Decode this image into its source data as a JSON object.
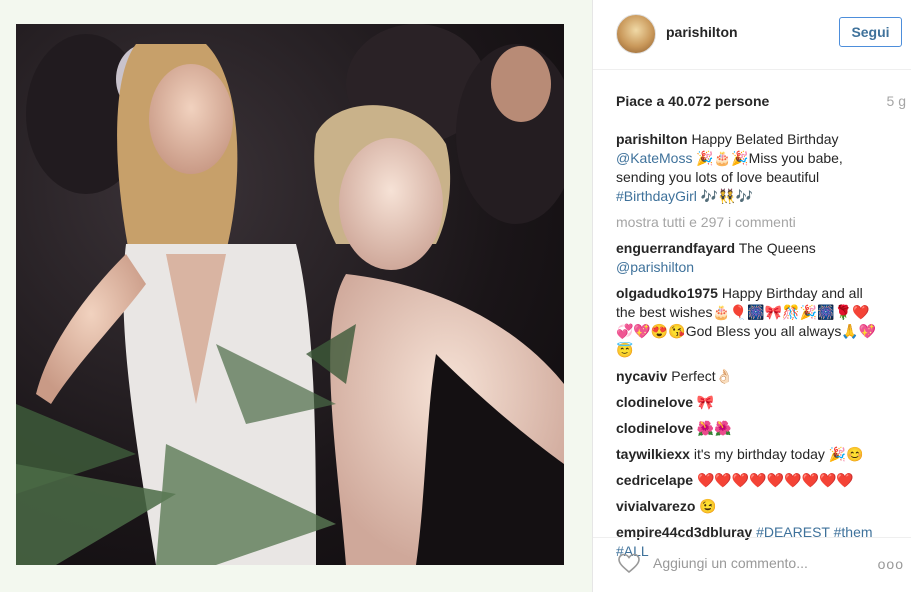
{
  "post": {
    "username": "parishilton",
    "follow_label": "Segui",
    "likes": "Piace a 40.072 persone",
    "age": "5 g",
    "view_all": "mostra tutti e 297 i commenti",
    "add_comment_placeholder": "Aggiungi un commento...",
    "options_label": "ooo"
  },
  "caption": {
    "user": "parishilton",
    "text1": "Happy Belated Birthday",
    "mention": "@KateMoss",
    "text2": "🎉🎂🎉Miss you babe, sending you lots of love beautiful",
    "hashtag": "#BirthdayGirl",
    "text3": "🎶👯🎶"
  },
  "comments": [
    {
      "user": "enguerrandfayard",
      "text": "The Queens",
      "link": "@parishilton"
    },
    {
      "user": "olgadudko1975",
      "text": "Happy Birthday and all the best wishes🎂🎈🎆🎀🎊🎉🎆🌹❤️💞💖😍😘God Bless you all always🙏💖😇"
    },
    {
      "user": "nycaviv",
      "text": "Perfect👌🏻"
    },
    {
      "user": "clodinelove",
      "text": "🎀"
    },
    {
      "user": "clodinelove",
      "text": "🌺🌺"
    },
    {
      "user": "taywilkiexx",
      "text": "it's my birthday today 🎉😊"
    },
    {
      "user": "cedricelape",
      "text": "❤️❤️❤️❤️❤️❤️❤️❤️❤️"
    },
    {
      "user": "vivialvarezo",
      "text": "😉"
    },
    {
      "user": "empire44cd3dbluray",
      "link": "#DEAREST #them #ALL"
    }
  ]
}
